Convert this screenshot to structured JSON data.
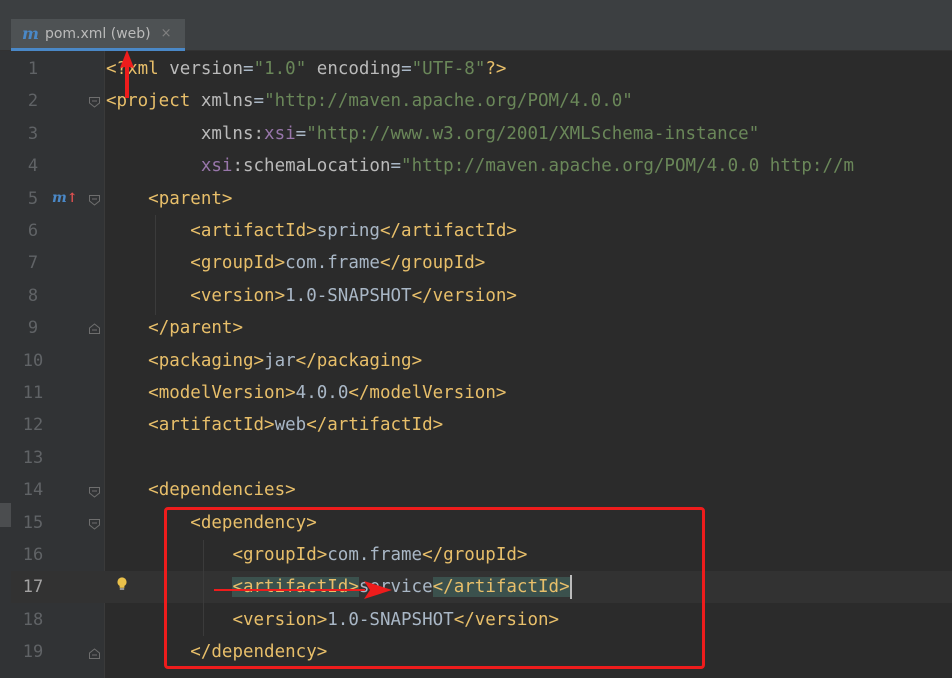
{
  "tab": {
    "icon": "m",
    "title": "pom.xml (web)",
    "close": "×"
  },
  "gutter": {
    "maven_marker": "m",
    "maven_marker_arrow": "↑"
  },
  "editor": {
    "current_line": 17,
    "lines": [
      {
        "num": "1",
        "tokens": [
          [
            "tag",
            "<"
          ],
          [
            "tag",
            "?"
          ],
          [
            "tag",
            "xml "
          ],
          [
            "attr",
            "version"
          ],
          [
            "txt",
            "="
          ],
          [
            "str",
            "\"1.0\""
          ],
          [
            "attr",
            " encoding"
          ],
          [
            "txt",
            "="
          ],
          [
            "str",
            "\"UTF-8\""
          ],
          [
            "tag",
            "?>"
          ]
        ]
      },
      {
        "num": "2",
        "tokens": [
          [
            "tag",
            "<project "
          ],
          [
            "attr",
            "xmlns"
          ],
          [
            "txt",
            "="
          ],
          [
            "str",
            "\"http://maven.apache.org/POM/4.0.0\""
          ]
        ]
      },
      {
        "num": "3",
        "tokens": [
          [
            "txt",
            "         "
          ],
          [
            "attr",
            "xmlns:"
          ],
          [
            "ns",
            "xsi"
          ],
          [
            "txt",
            "="
          ],
          [
            "str",
            "\"http://www.w3.org/2001/XMLSchema-instance\""
          ]
        ]
      },
      {
        "num": "4",
        "tokens": [
          [
            "txt",
            "         "
          ],
          [
            "ns",
            "xsi"
          ],
          [
            "attr",
            ":schemaLocation"
          ],
          [
            "txt",
            "="
          ],
          [
            "str",
            "\"http://maven.apache.org/POM/4.0.0 http://m"
          ]
        ]
      },
      {
        "num": "5",
        "tokens": [
          [
            "txt",
            "    "
          ],
          [
            "tag",
            "<parent>"
          ]
        ]
      },
      {
        "num": "6",
        "tokens": [
          [
            "txt",
            "        "
          ],
          [
            "tag",
            "<artifactId>"
          ],
          [
            "txt",
            "spring"
          ],
          [
            "tag",
            "</artifactId>"
          ]
        ]
      },
      {
        "num": "7",
        "tokens": [
          [
            "txt",
            "        "
          ],
          [
            "tag",
            "<groupId>"
          ],
          [
            "txt",
            "com.frame"
          ],
          [
            "tag",
            "</groupId>"
          ]
        ]
      },
      {
        "num": "8",
        "tokens": [
          [
            "txt",
            "        "
          ],
          [
            "tag",
            "<version>"
          ],
          [
            "txt",
            "1.0-SNAPSHOT"
          ],
          [
            "tag",
            "</version>"
          ]
        ]
      },
      {
        "num": "9",
        "tokens": [
          [
            "txt",
            "    "
          ],
          [
            "tag",
            "</parent>"
          ]
        ]
      },
      {
        "num": "10",
        "tokens": [
          [
            "txt",
            "    "
          ],
          [
            "tag",
            "<packaging>"
          ],
          [
            "txt",
            "jar"
          ],
          [
            "tag",
            "</packaging>"
          ]
        ]
      },
      {
        "num": "11",
        "tokens": [
          [
            "txt",
            "    "
          ],
          [
            "tag",
            "<modelVersion>"
          ],
          [
            "txt",
            "4.0.0"
          ],
          [
            "tag",
            "</modelVersion>"
          ]
        ]
      },
      {
        "num": "12",
        "tokens": [
          [
            "txt",
            "    "
          ],
          [
            "tag",
            "<artifactId>"
          ],
          [
            "txt",
            "web"
          ],
          [
            "tag",
            "</artifactId>"
          ]
        ]
      },
      {
        "num": "13",
        "tokens": []
      },
      {
        "num": "14",
        "tokens": [
          [
            "txt",
            "    "
          ],
          [
            "tag",
            "<dependencies>"
          ]
        ]
      },
      {
        "num": "15",
        "tokens": [
          [
            "txt",
            "        "
          ],
          [
            "tag",
            "<dependency>"
          ]
        ]
      },
      {
        "num": "16",
        "tokens": [
          [
            "txt",
            "            "
          ],
          [
            "tag",
            "<groupId>"
          ],
          [
            "txt",
            "com.frame"
          ],
          [
            "tag",
            "</groupId>"
          ]
        ]
      },
      {
        "num": "17",
        "tokens": [
          [
            "txt",
            "            "
          ],
          [
            "tag hl",
            "<artifactId>"
          ],
          [
            "txt",
            "service"
          ],
          [
            "tag hl",
            "</artifactId>"
          ]
        ]
      },
      {
        "num": "18",
        "tokens": [
          [
            "txt",
            "            "
          ],
          [
            "tag",
            "<version>"
          ],
          [
            "txt",
            "1.0-SNAPSHOT"
          ],
          [
            "tag",
            "</version>"
          ]
        ]
      },
      {
        "num": "19",
        "tokens": [
          [
            "txt",
            "        "
          ],
          [
            "tag",
            "</dependency>"
          ]
        ]
      }
    ]
  },
  "colors": {
    "background": "#2b2b2b",
    "tag": "#e8bf6a",
    "attribute": "#bababa",
    "namespace": "#9876aa",
    "string": "#6a8759",
    "text": "#a9b7c6",
    "annotation": "#ee1c1c"
  }
}
